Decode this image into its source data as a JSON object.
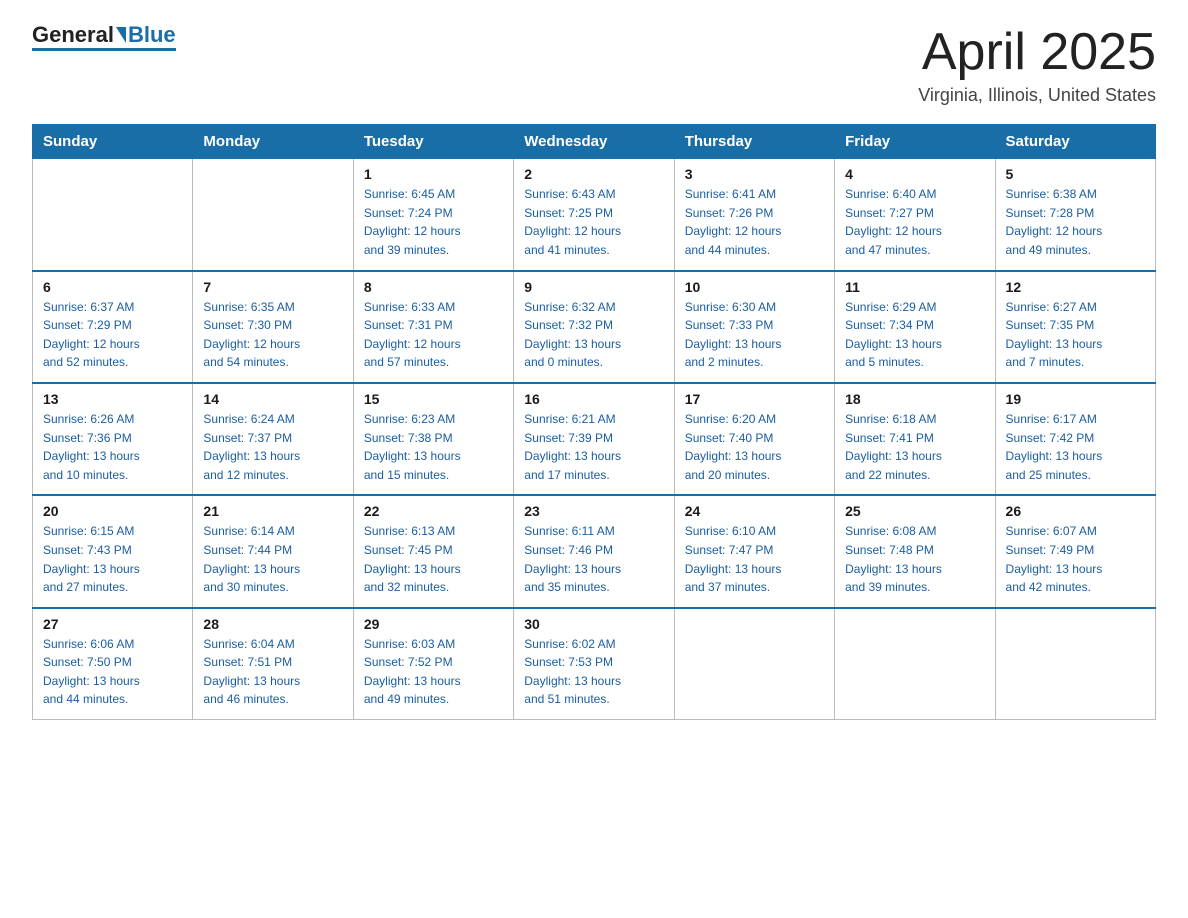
{
  "header": {
    "logo_general": "General",
    "logo_blue": "Blue",
    "month_title": "April 2025",
    "subtitle": "Virginia, Illinois, United States"
  },
  "days_of_week": [
    "Sunday",
    "Monday",
    "Tuesday",
    "Wednesday",
    "Thursday",
    "Friday",
    "Saturday"
  ],
  "weeks": [
    [
      {
        "day": "",
        "info": ""
      },
      {
        "day": "",
        "info": ""
      },
      {
        "day": "1",
        "info": "Sunrise: 6:45 AM\nSunset: 7:24 PM\nDaylight: 12 hours\nand 39 minutes."
      },
      {
        "day": "2",
        "info": "Sunrise: 6:43 AM\nSunset: 7:25 PM\nDaylight: 12 hours\nand 41 minutes."
      },
      {
        "day": "3",
        "info": "Sunrise: 6:41 AM\nSunset: 7:26 PM\nDaylight: 12 hours\nand 44 minutes."
      },
      {
        "day": "4",
        "info": "Sunrise: 6:40 AM\nSunset: 7:27 PM\nDaylight: 12 hours\nand 47 minutes."
      },
      {
        "day": "5",
        "info": "Sunrise: 6:38 AM\nSunset: 7:28 PM\nDaylight: 12 hours\nand 49 minutes."
      }
    ],
    [
      {
        "day": "6",
        "info": "Sunrise: 6:37 AM\nSunset: 7:29 PM\nDaylight: 12 hours\nand 52 minutes."
      },
      {
        "day": "7",
        "info": "Sunrise: 6:35 AM\nSunset: 7:30 PM\nDaylight: 12 hours\nand 54 minutes."
      },
      {
        "day": "8",
        "info": "Sunrise: 6:33 AM\nSunset: 7:31 PM\nDaylight: 12 hours\nand 57 minutes."
      },
      {
        "day": "9",
        "info": "Sunrise: 6:32 AM\nSunset: 7:32 PM\nDaylight: 13 hours\nand 0 minutes."
      },
      {
        "day": "10",
        "info": "Sunrise: 6:30 AM\nSunset: 7:33 PM\nDaylight: 13 hours\nand 2 minutes."
      },
      {
        "day": "11",
        "info": "Sunrise: 6:29 AM\nSunset: 7:34 PM\nDaylight: 13 hours\nand 5 minutes."
      },
      {
        "day": "12",
        "info": "Sunrise: 6:27 AM\nSunset: 7:35 PM\nDaylight: 13 hours\nand 7 minutes."
      }
    ],
    [
      {
        "day": "13",
        "info": "Sunrise: 6:26 AM\nSunset: 7:36 PM\nDaylight: 13 hours\nand 10 minutes."
      },
      {
        "day": "14",
        "info": "Sunrise: 6:24 AM\nSunset: 7:37 PM\nDaylight: 13 hours\nand 12 minutes."
      },
      {
        "day": "15",
        "info": "Sunrise: 6:23 AM\nSunset: 7:38 PM\nDaylight: 13 hours\nand 15 minutes."
      },
      {
        "day": "16",
        "info": "Sunrise: 6:21 AM\nSunset: 7:39 PM\nDaylight: 13 hours\nand 17 minutes."
      },
      {
        "day": "17",
        "info": "Sunrise: 6:20 AM\nSunset: 7:40 PM\nDaylight: 13 hours\nand 20 minutes."
      },
      {
        "day": "18",
        "info": "Sunrise: 6:18 AM\nSunset: 7:41 PM\nDaylight: 13 hours\nand 22 minutes."
      },
      {
        "day": "19",
        "info": "Sunrise: 6:17 AM\nSunset: 7:42 PM\nDaylight: 13 hours\nand 25 minutes."
      }
    ],
    [
      {
        "day": "20",
        "info": "Sunrise: 6:15 AM\nSunset: 7:43 PM\nDaylight: 13 hours\nand 27 minutes."
      },
      {
        "day": "21",
        "info": "Sunrise: 6:14 AM\nSunset: 7:44 PM\nDaylight: 13 hours\nand 30 minutes."
      },
      {
        "day": "22",
        "info": "Sunrise: 6:13 AM\nSunset: 7:45 PM\nDaylight: 13 hours\nand 32 minutes."
      },
      {
        "day": "23",
        "info": "Sunrise: 6:11 AM\nSunset: 7:46 PM\nDaylight: 13 hours\nand 35 minutes."
      },
      {
        "day": "24",
        "info": "Sunrise: 6:10 AM\nSunset: 7:47 PM\nDaylight: 13 hours\nand 37 minutes."
      },
      {
        "day": "25",
        "info": "Sunrise: 6:08 AM\nSunset: 7:48 PM\nDaylight: 13 hours\nand 39 minutes."
      },
      {
        "day": "26",
        "info": "Sunrise: 6:07 AM\nSunset: 7:49 PM\nDaylight: 13 hours\nand 42 minutes."
      }
    ],
    [
      {
        "day": "27",
        "info": "Sunrise: 6:06 AM\nSunset: 7:50 PM\nDaylight: 13 hours\nand 44 minutes."
      },
      {
        "day": "28",
        "info": "Sunrise: 6:04 AM\nSunset: 7:51 PM\nDaylight: 13 hours\nand 46 minutes."
      },
      {
        "day": "29",
        "info": "Sunrise: 6:03 AM\nSunset: 7:52 PM\nDaylight: 13 hours\nand 49 minutes."
      },
      {
        "day": "30",
        "info": "Sunrise: 6:02 AM\nSunset: 7:53 PM\nDaylight: 13 hours\nand 51 minutes."
      },
      {
        "day": "",
        "info": ""
      },
      {
        "day": "",
        "info": ""
      },
      {
        "day": "",
        "info": ""
      }
    ]
  ]
}
